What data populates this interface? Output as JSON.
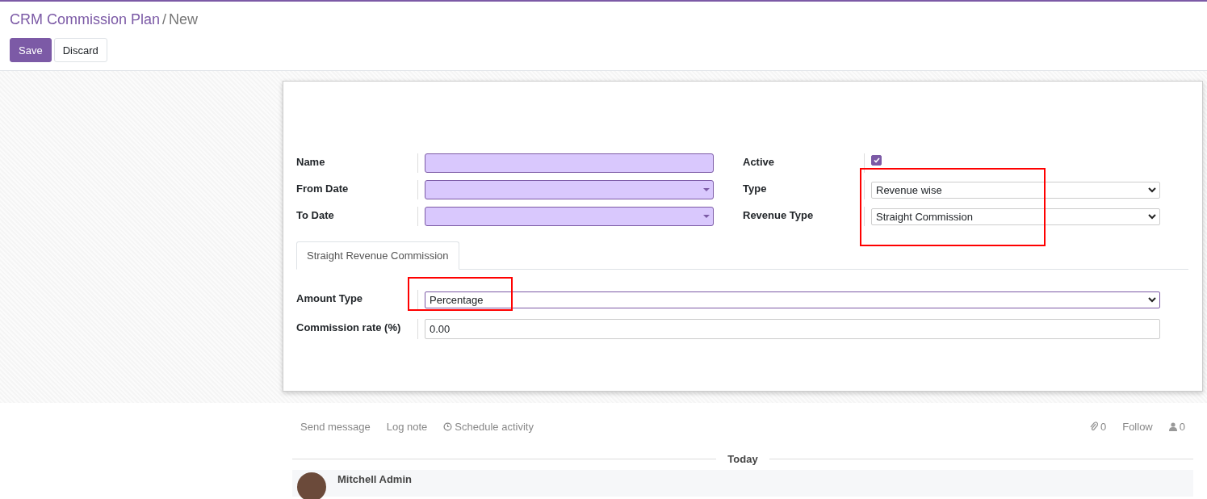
{
  "breadcrumb": {
    "parent": "CRM Commission Plan",
    "separator": "/",
    "current": "New"
  },
  "buttons": [
    {
      "label": "Save",
      "kind": "primary"
    },
    {
      "label": "Discard",
      "kind": "secondary"
    }
  ],
  "left_fields": [
    {
      "label": "Name",
      "kind": "text",
      "required": true
    },
    {
      "label": "From Date",
      "kind": "date",
      "required": true
    },
    {
      "label": "To Date",
      "kind": "date",
      "required": true
    }
  ],
  "right_fields": [
    {
      "label": "Active",
      "kind": "checkbox",
      "checked": true
    },
    {
      "label": "Type",
      "kind": "select",
      "value": "Revenue wise"
    },
    {
      "label": "Revenue Type",
      "kind": "select",
      "value": "Straight Commission"
    }
  ],
  "tabs": [
    {
      "label": "Straight Revenue Commission",
      "selected": true
    }
  ],
  "tab_fields": [
    {
      "label": "Amount Type",
      "kind": "select",
      "value": "Percentage",
      "focused": true
    },
    {
      "label": "Commission rate (%)",
      "kind": "text",
      "value": "0.00"
    }
  ],
  "chatter": {
    "actions": [
      {
        "label": "Send message",
        "kind": "plain"
      },
      {
        "label": "Log note",
        "kind": "plain"
      },
      {
        "label": "Schedule activity",
        "kind": "clock"
      }
    ],
    "attachments": "0",
    "follow": "Follow",
    "followers": "0",
    "date_divider": "Today",
    "message_author": "Mitchell Admin"
  }
}
